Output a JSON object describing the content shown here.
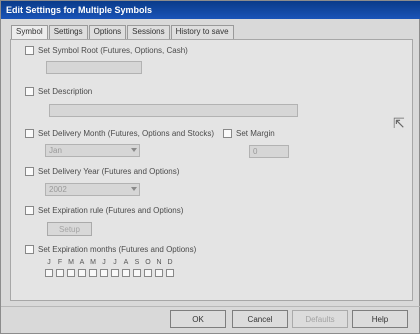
{
  "window": {
    "title": "Edit Settings for Multiple Symbols"
  },
  "tabs": [
    "Symbol",
    "Settings",
    "Options",
    "Sessions",
    "History to save"
  ],
  "fields": {
    "symbol_root": {
      "label": "Set Symbol Root (Futures, Options, Cash)",
      "value": ""
    },
    "description": {
      "label": "Set Description",
      "value": ""
    },
    "delivery_month": {
      "label": "Set Delivery Month (Futures, Options and Stocks)",
      "value": "Jan"
    },
    "margin": {
      "label": "Set Margin",
      "value": "0"
    },
    "delivery_year": {
      "label": "Set Delivery Year (Futures and Options)",
      "value": "2002"
    },
    "expiration_rule": {
      "label": "Set Expiration rule (Futures and Options)",
      "button": "Setup"
    },
    "expiration_months": {
      "label": "Set Expiration months (Futures and Options)",
      "months": [
        "J",
        "F",
        "M",
        "A",
        "M",
        "J",
        "J",
        "A",
        "S",
        "O",
        "N",
        "D"
      ]
    }
  },
  "buttons": {
    "ok": "OK",
    "cancel": "Cancel",
    "defaults": "Defaults",
    "help": "Help"
  }
}
